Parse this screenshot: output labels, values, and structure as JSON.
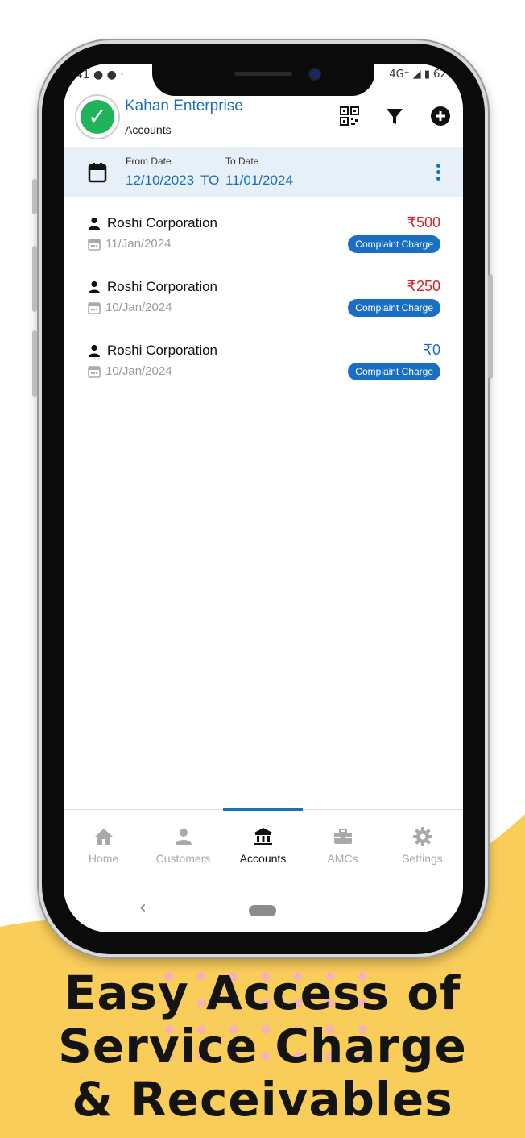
{
  "colors": {
    "accent": "#1a6fb8",
    "badge": "#1b6fc2",
    "negative_amount": "#c62828",
    "zero_amount": "#1a6fb8",
    "backdrop": "#f9cd5a"
  },
  "status_bar": {
    "time": ":41",
    "right": "4G⁺ ◢ ▮ 62%"
  },
  "header": {
    "title": "Kahan Enterprise",
    "subtitle": "Accounts",
    "icons": [
      "qr-code-icon",
      "filter-icon",
      "add-circle-icon"
    ]
  },
  "date_range": {
    "from_label": "From Date",
    "from_value": "12/10/2023",
    "to_word": "TO",
    "to_label": "To Date",
    "to_value": "11/01/2024"
  },
  "entries": [
    {
      "name": "Roshi Corporation",
      "date": "11/Jan/2024",
      "amount": "₹500",
      "badge": "Complaint Charge",
      "amount_color": "#c62828"
    },
    {
      "name": "Roshi Corporation",
      "date": "10/Jan/2024",
      "amount": "₹250",
      "badge": "Complaint Charge",
      "amount_color": "#c62828"
    },
    {
      "name": "Roshi Corporation",
      "date": "10/Jan/2024",
      "amount": "₹0",
      "badge": "Complaint Charge",
      "amount_color": "#1a6fb8"
    }
  ],
  "nav": {
    "items": [
      {
        "label": "Home",
        "icon": "home-icon"
      },
      {
        "label": "Customers",
        "icon": "person-icon"
      },
      {
        "label": "Accounts",
        "icon": "bank-icon"
      },
      {
        "label": "AMCs",
        "icon": "briefcase-icon"
      },
      {
        "label": "Settings",
        "icon": "gear-icon"
      }
    ],
    "active": "Accounts"
  },
  "system_nav": {
    "back": "‹"
  },
  "caption": {
    "line1": "Easy Access of",
    "line2": "Service Charge",
    "line3": "& Receivables"
  }
}
